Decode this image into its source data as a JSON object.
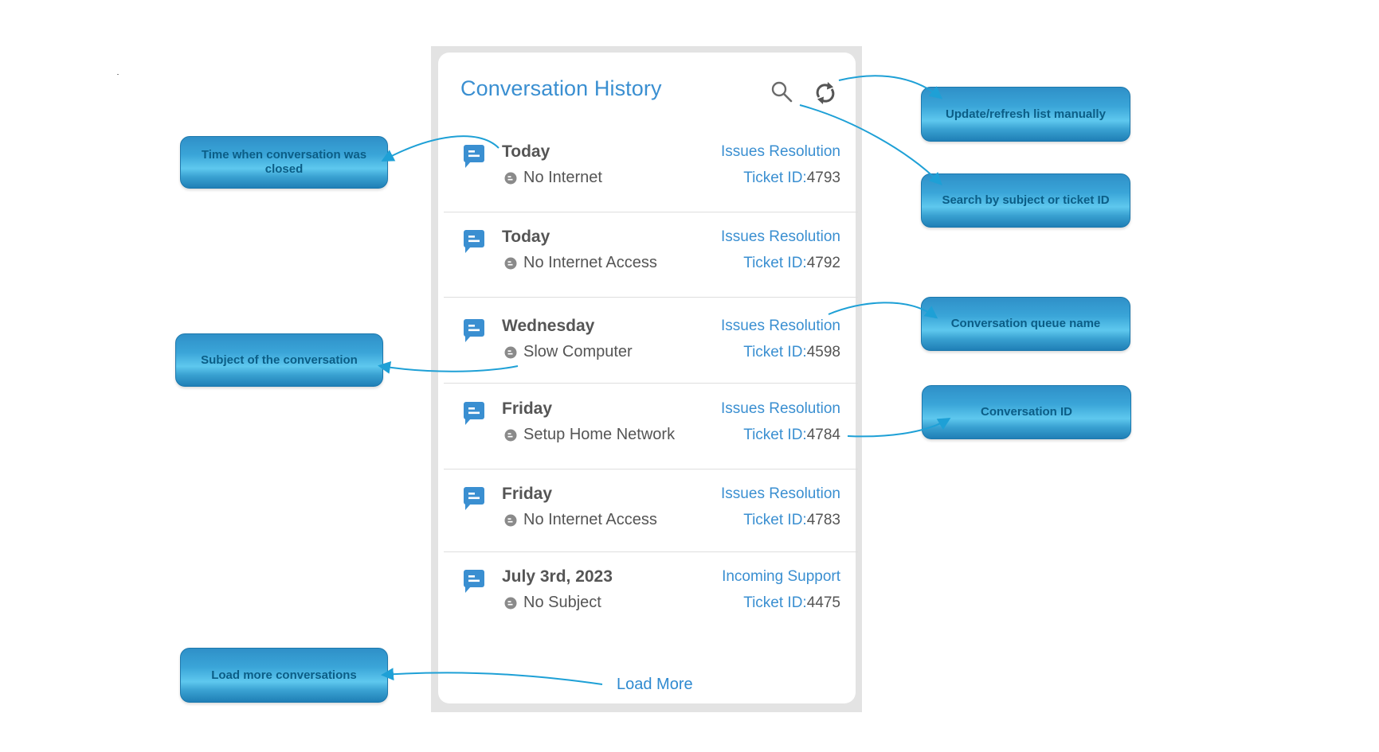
{
  "panel": {
    "title": "Conversation History",
    "search_icon": "search-icon",
    "refresh_icon": "refresh-icon",
    "conversations": [
      {
        "date": "Today",
        "subject": "No Internet",
        "queue": "Issues Resolution",
        "ticket_label": "Ticket ID:",
        "ticket_id": "4793"
      },
      {
        "date": "Today",
        "subject": "No Internet Access",
        "queue": "Issues Resolution",
        "ticket_label": "Ticket ID:",
        "ticket_id": "4792"
      },
      {
        "date": "Wednesday",
        "subject": "Slow Computer",
        "queue": "Issues Resolution",
        "ticket_label": "Ticket ID:",
        "ticket_id": "4598"
      },
      {
        "date": "Friday",
        "subject": "Setup Home Network",
        "queue": "Issues Resolution",
        "ticket_label": "Ticket ID:",
        "ticket_id": "4784"
      },
      {
        "date": "Friday",
        "subject": "No Internet Access",
        "queue": "Issues Resolution",
        "ticket_label": "Ticket ID:",
        "ticket_id": "4783"
      },
      {
        "date": "July 3rd, 2023",
        "subject": "No Subject",
        "queue": "Incoming Support",
        "ticket_label": "Ticket ID:",
        "ticket_id": "4475"
      }
    ],
    "load_more_label": "Load More"
  },
  "callouts": {
    "time_closed": "Time when conversation was closed",
    "subject": "Subject of the conversation",
    "load_more": "Load more conversations",
    "refresh": "Update/refresh list manually",
    "search": "Search by subject or ticket ID",
    "queue": "Conversation queue name",
    "conversation_id": "Conversation ID"
  },
  "colors": {
    "accent": "#3a8fd1",
    "text": "#555555",
    "callout_text": "#0b5d86",
    "connector": "#1ea0d6"
  }
}
